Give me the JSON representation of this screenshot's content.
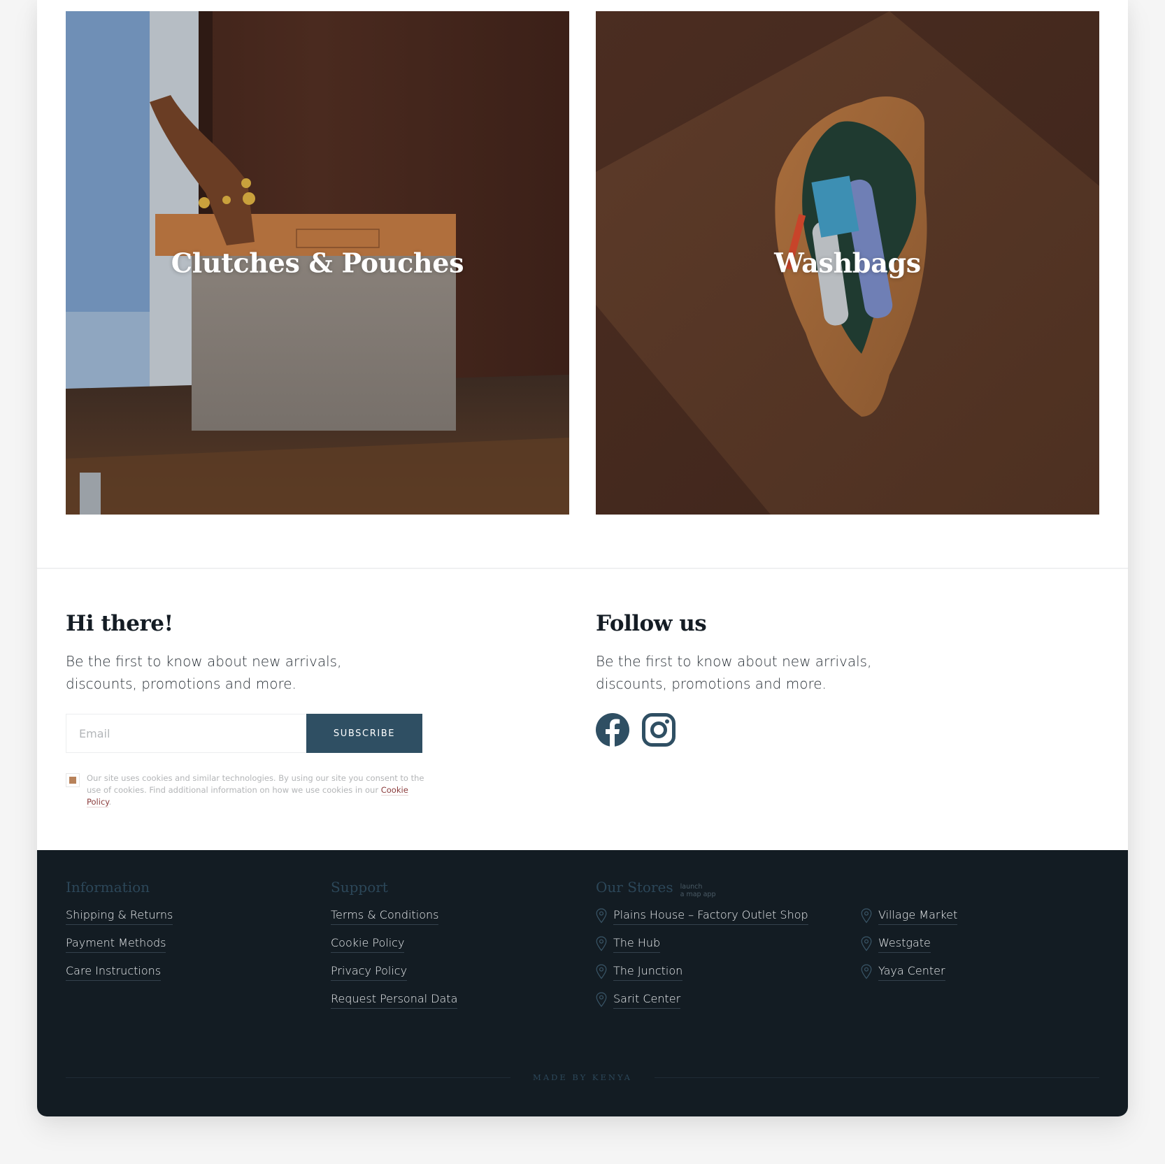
{
  "categories": [
    {
      "title": "Clutches & Pouches",
      "image": "clutch-pouch-photo"
    },
    {
      "title": "Washbags",
      "image": "washbag-photo"
    }
  ],
  "newsletter": {
    "heading": "Hi there!",
    "text": "Be the first to know about new arrivals, discounts, promotions and more.",
    "email_placeholder": "Email",
    "email_value": "",
    "subscribe_label": "SUBSCRIBE",
    "consent_checked": true,
    "consent_text": "Our site uses cookies and similar technologies. By using our site you consent to the use of cookies. Find additional information on how we use cookies in our ",
    "consent_link": "Cookie Policy",
    "consent_end": "."
  },
  "follow": {
    "heading": "Follow us",
    "text": "Be the first to know about new arrivals, discounts, promotions and more.",
    "icons": [
      "facebook-icon",
      "instagram-icon"
    ]
  },
  "colors": {
    "accent": "#2f4f63",
    "footer_bg": "#131c23",
    "checkbox": "#b8825a",
    "link_red": "#8a3a3a"
  },
  "footer": {
    "information": {
      "heading": "Information",
      "links": [
        "Shipping & Returns",
        "Payment Methods",
        "Care Instructions"
      ]
    },
    "support": {
      "heading": "Support",
      "links": [
        "Terms & Conditions",
        "Cookie Policy",
        "Privacy Policy",
        "Request Personal Data"
      ]
    },
    "stores": {
      "heading": "Our Stores",
      "sub_line1": "launch",
      "sub_line2": "a map app",
      "col1": [
        "Plains House – Factory Outlet Shop",
        "The Hub",
        "The Junction",
        "Sarit Center"
      ],
      "col2": [
        "Village Market",
        "Westgate",
        "Yaya Center"
      ]
    },
    "made_by": "MADE BY KENYA"
  }
}
